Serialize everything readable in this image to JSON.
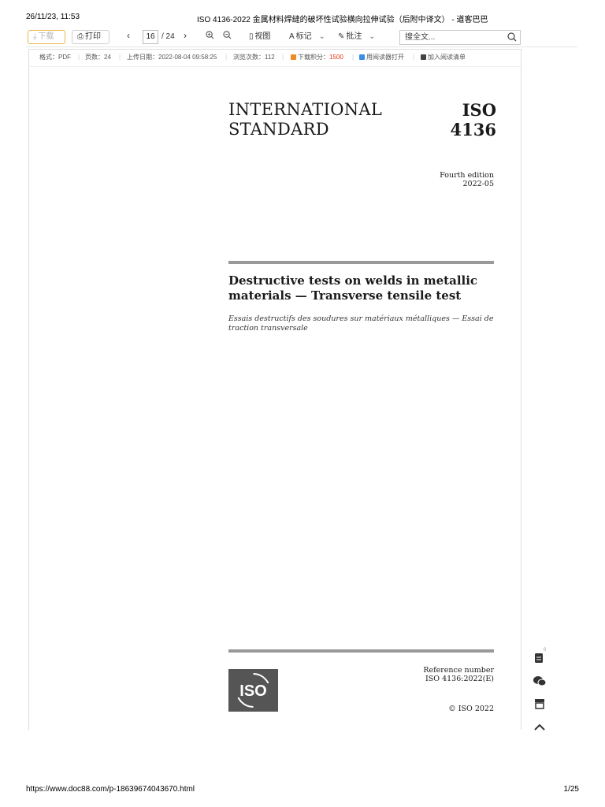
{
  "print_header": {
    "timestamp": "26/11/23, 11:53",
    "title": "ISO 4136-2022 金属材料焊缝的破坏性试验横向拉伸试验（后附中译文） - 道客巴巴"
  },
  "toolbar": {
    "download_label": "下载",
    "print_label": "打印",
    "current_page": "16",
    "total_pages": "/ 24",
    "view_label": "视图",
    "mark_label": "标记",
    "annotate_label": "批注",
    "search_placeholder": "搜全文..."
  },
  "info_bar": {
    "format": "格式：PDF",
    "pages": "页数：24",
    "upload_date": "上传日期：2022-08-04 09:58:25",
    "views": "浏览次数：112",
    "points_label": "下载积分：",
    "points_value": "1500",
    "open_reader": "用阅读器打开",
    "add_list": "加入阅读清单"
  },
  "document": {
    "heading_line1": "INTERNATIONAL",
    "heading_line2": "STANDARD",
    "iso_label": "ISO",
    "iso_number": "4136",
    "edition": "Fourth edition",
    "edition_date": "2022-05",
    "title": "Destructive tests on welds in metallic materials — Transverse tensile test",
    "subtitle": "Essais destructifs des soudures sur matériaux métalliques — Essai de traction transversale",
    "reference_label": "Reference number",
    "reference_number": "ISO 4136:2022(E)",
    "copyright": "© ISO 2022",
    "logo_text": "ISO"
  },
  "side": {
    "notes_badge": "0"
  },
  "print_footer": {
    "url": "https://www.doc88.com/p-18639674043670.html",
    "page": "1/25"
  },
  "colors": {
    "points_red": "#e8340f",
    "download_border": "#e6b84d",
    "rule_gray": "#999999",
    "logo_gray": "#555555"
  }
}
